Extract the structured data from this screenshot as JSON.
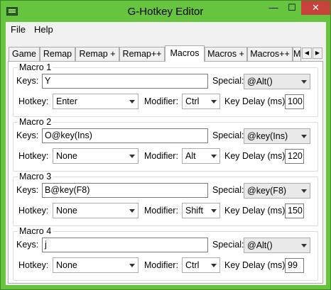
{
  "window": {
    "title": "G-Hotkey Editor",
    "icon": "keyboard-icon",
    "controls": {
      "minimize": "—",
      "maximize": "☐",
      "close": "✕"
    }
  },
  "menu": [
    "File",
    "Help"
  ],
  "tabs": [
    "Game",
    "Remap",
    "Remap +",
    "Remap++",
    "Macros",
    "Macros +",
    "Macros++",
    "M"
  ],
  "active_tab": "Macros",
  "tab_scroll": {
    "left": "◀",
    "right": "▶"
  },
  "labels": {
    "keys": "Keys:",
    "special": "Special:",
    "hotkey": "Hotkey:",
    "modifier": "Modifier:",
    "delay": "Key Delay (ms):"
  },
  "macros": [
    {
      "title": "Macro 1",
      "keys": "Y",
      "special": "@Alt()",
      "hotkey": "Enter",
      "modifier": "Ctrl",
      "delay": "100"
    },
    {
      "title": "Macro 2",
      "keys": "O@key(Ins)",
      "special": "@key(Ins)",
      "hotkey": "None",
      "modifier": "Alt",
      "delay": "120"
    },
    {
      "title": "Macro 3",
      "keys": "B@key(F8)",
      "special": "@key(F8)",
      "hotkey": "None",
      "modifier": "Shift",
      "delay": "150"
    },
    {
      "title": "Macro 4",
      "keys": "j",
      "special": "@Alt()",
      "hotkey": "None",
      "modifier": "Ctrl",
      "delay": "99"
    }
  ],
  "colors": {
    "titlebar": "#66c43f",
    "close_button": "#c7423b"
  }
}
